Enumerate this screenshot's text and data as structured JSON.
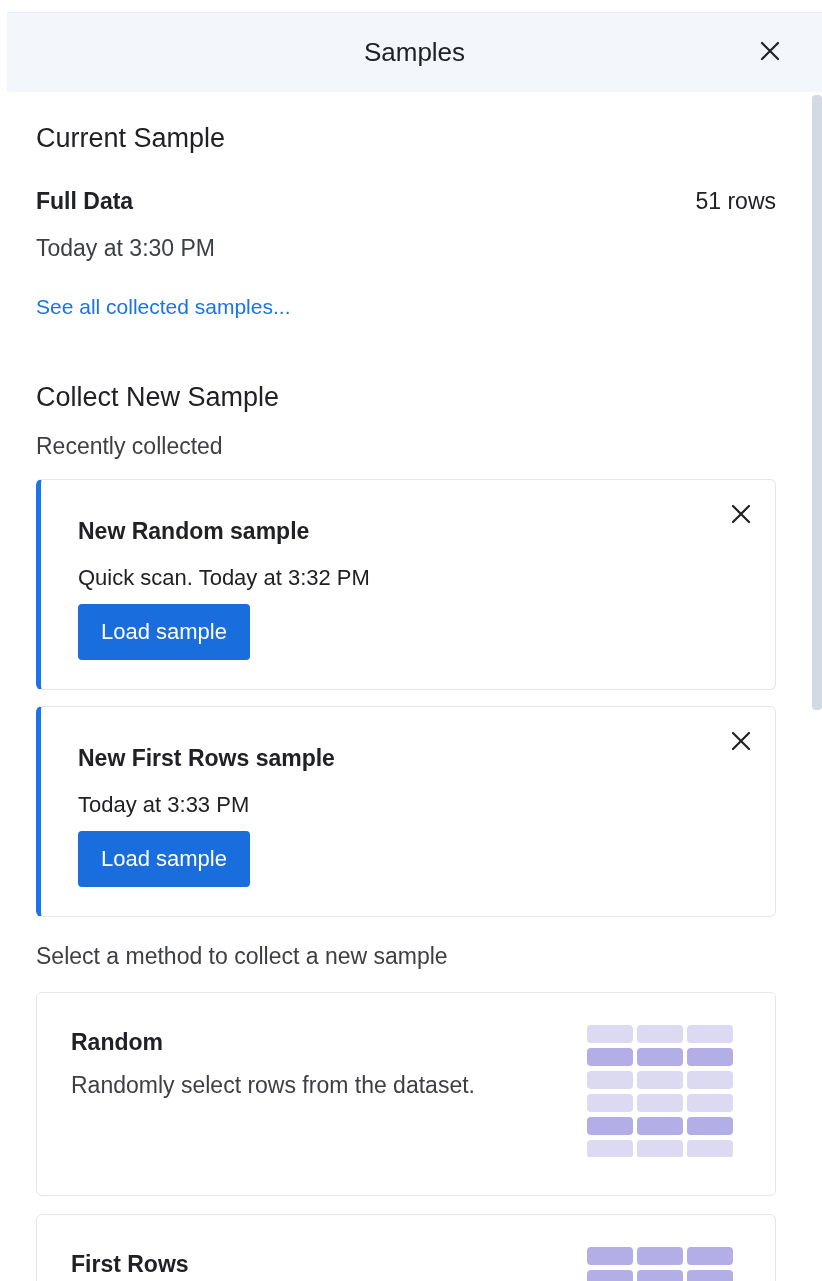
{
  "header": {
    "title": "Samples"
  },
  "current_sample": {
    "heading": "Current Sample",
    "name": "Full Data",
    "rows": "51 rows",
    "time": "Today at 3:30 PM",
    "link": "See all collected samples..."
  },
  "collect": {
    "heading": "Collect New Sample",
    "recent_label": "Recently collected",
    "recent": [
      {
        "title": "New Random sample",
        "detail": "Quick scan. Today at 3:32 PM",
        "button": "Load sample"
      },
      {
        "title": "New First Rows sample",
        "detail": "Today at 3:33 PM",
        "button": "Load sample"
      }
    ],
    "methods_label": "Select a method to collect a new sample",
    "methods": [
      {
        "kind": "random",
        "title": "Random",
        "description": "Randomly select rows from the dataset."
      },
      {
        "kind": "first_rows",
        "title": "First Rows"
      }
    ]
  }
}
